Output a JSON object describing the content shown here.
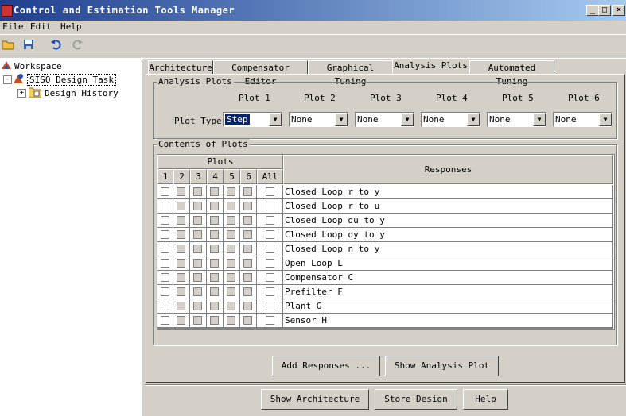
{
  "window": {
    "title": "Control and Estimation Tools Manager",
    "minimize": "_",
    "maximize": "□",
    "close": "×"
  },
  "menu": [
    "File",
    "Edit",
    "Help"
  ],
  "tree": {
    "workspace": "Workspace",
    "task": "SISO Design Task",
    "history": "Design History",
    "expander": "+",
    "collapser": "-"
  },
  "tabs": [
    "Architecture",
    "Compensator Editor",
    "Graphical Tuning",
    "Analysis Plots",
    "Automated Tuning"
  ],
  "analysis": {
    "group_label": "Analysis Plots",
    "plot_type_label": "Plot Type",
    "plots": [
      {
        "head": "Plot 1",
        "value": "Step"
      },
      {
        "head": "Plot 2",
        "value": "None"
      },
      {
        "head": "Plot 3",
        "value": "None"
      },
      {
        "head": "Plot 4",
        "value": "None"
      },
      {
        "head": "Plot 5",
        "value": "None"
      },
      {
        "head": "Plot 6",
        "value": "None"
      }
    ]
  },
  "contents": {
    "group_label": "Contents of Plots",
    "plots_header": "Plots",
    "col_headers": [
      "1",
      "2",
      "3",
      "4",
      "5",
      "6",
      "All"
    ],
    "responses_header": "Responses",
    "rows": [
      "Closed Loop r to y",
      "Closed Loop r to u",
      "Closed Loop du to y",
      "Closed Loop dy to y",
      "Closed Loop n to y",
      "Open Loop L",
      "Compensator C",
      "Prefilter F",
      "Plant G",
      "Sensor H"
    ]
  },
  "buttons": {
    "add_responses": "Add Responses ...",
    "show_analysis_plot": "Show Analysis Plot",
    "show_architecture": "Show Architecture",
    "store_design": "Store Design",
    "help": "Help"
  },
  "icons": {
    "app": "matlab-icon",
    "open": "folder-open-icon",
    "save": "save-icon",
    "undo": "undo-icon",
    "redo": "redo-icon"
  }
}
